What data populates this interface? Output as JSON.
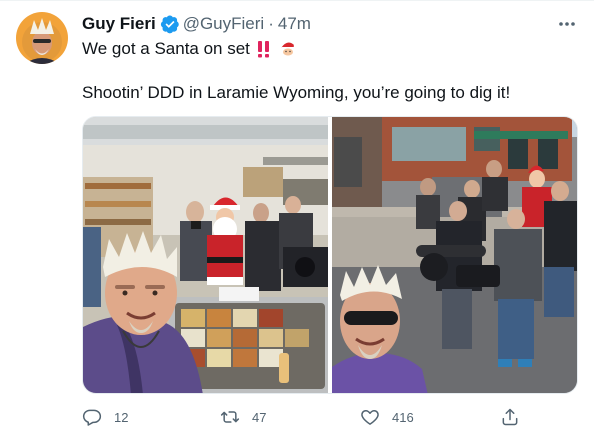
{
  "author": {
    "display_name": "Guy Fieri",
    "handle": "@GuyFieri",
    "separator": "·",
    "timestamp": "47m",
    "verified_icon": "verified-badge-icon"
  },
  "tweet": {
    "line1": "We got a Santa on set",
    "line1_emojis": [
      "double-exclamation-icon",
      "santa-emoji-icon"
    ],
    "line2": "Shootin’ DDD in Laramie Wyoming, you’re going to dig it!"
  },
  "media": {
    "photos": [
      "kitchen-selfie-with-santa",
      "street-selfie-with-crew"
    ]
  },
  "actions": {
    "reply_count": "12",
    "retweet_count": "47",
    "like_count": "416",
    "share_count": ""
  },
  "colors": {
    "text": "#0f1419",
    "secondary": "#536471",
    "verified": "#1d9bf0",
    "exclaim": "#e0245e"
  }
}
